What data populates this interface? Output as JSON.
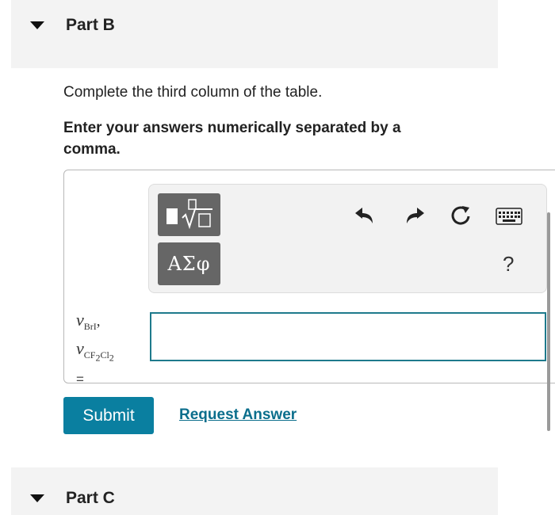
{
  "part_b": {
    "title": "Part B"
  },
  "instructions": {
    "line1": "Complete the third column of the table.",
    "line2": "Enter your answers numerically separated by a comma."
  },
  "toolbar": {
    "templates_icon": "templates-icon",
    "symbols_label": "ΑΣφ",
    "undo_icon": "undo-icon",
    "redo_icon": "redo-icon",
    "reset_icon": "reset-icon",
    "keyboard_icon": "keyboard-icon",
    "help_label": "?"
  },
  "answer": {
    "label_var1": "ν",
    "label_sub1": "BrI",
    "label_var2": "ν",
    "label_sub2a": "CF",
    "label_sub2b": "2",
    "label_sub2c": "Cl",
    "label_sub2d": "2",
    "separator": ",",
    "equals": "=",
    "value": "",
    "placeholder": ""
  },
  "actions": {
    "submit_label": "Submit",
    "request_label": "Request Answer"
  },
  "part_c": {
    "title": "Part C"
  },
  "colors": {
    "accent": "#0a7fa0",
    "link": "#0b6e8c",
    "input_border": "#1e7a8c",
    "tool_btn": "#666666"
  }
}
